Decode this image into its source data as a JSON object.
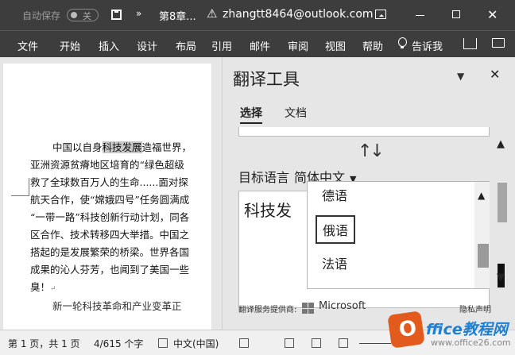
{
  "titlebar": {
    "autosave_label": "自动保存",
    "autosave_state": "关",
    "more": "»",
    "doc_name": "第8章...",
    "warning": "⚠",
    "account": "zhangtt8464@outlook.com",
    "close": "✕"
  },
  "menu": {
    "items": [
      "文件",
      "开始",
      "插入",
      "设计",
      "布局",
      "引用",
      "邮件",
      "审阅",
      "视图",
      "帮助"
    ],
    "tell_me": "告诉我"
  },
  "document": {
    "lines": [
      [
        "中国以自身",
        "科技发展",
        "造福世界，"
      ],
      [
        "亚洲资源贫瘠地区培育的“绿色超级"
      ],
      [
        "救了全球数百万人的生命......面对探"
      ],
      [
        "航天合作，使“嫦娥四号”任务圆满成"
      ],
      [
        "“一带一路”科技创新行动计划，同各"
      ],
      [
        "区合作、技术转移四大举措。中国之"
      ],
      [
        "搭起的是发展繁荣的桥梁。世界各国"
      ],
      [
        "成果的沁人芬芳，也闻到了美国一些"
      ],
      [
        "臭！"
      ]
    ],
    "para_mark": "↵",
    "cut_line": "新一轮科技革命和产业变革正"
  },
  "pane": {
    "title": "翻译工具",
    "menu_caret": "▼",
    "close": "✕",
    "tabs": [
      "选择",
      "文档"
    ],
    "swap": "↑↓",
    "target_label": "目标语言",
    "target_value": "简体中文",
    "target_caret": "▼",
    "output_text": "科技发",
    "options": [
      "德语",
      "俄语",
      "法语"
    ],
    "dd_up": "▲",
    "scroll_up": "▲",
    "scroll_down": "▼",
    "provider_label": "翻译服务提供商:",
    "provider_name": "Microsoft",
    "privacy": "隐私声明"
  },
  "status": {
    "page": "第 1 页，共 1 页",
    "words": "4/615 个字",
    "lang": "中文(中国)"
  },
  "watermark": {
    "badge": "O",
    "brand": "ffice教程网",
    "url": "www.office26.com"
  }
}
